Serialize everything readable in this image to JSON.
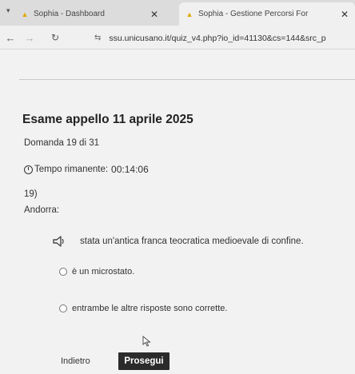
{
  "browser": {
    "tabs": [
      {
        "title": "Sophia - Dashboard",
        "active": false
      },
      {
        "title": "Sophia - Gestione Percorsi For",
        "active": true
      }
    ],
    "url": "ssu.unicusano.it/quiz_v4.php?io_id=41130&cs=144&src_p"
  },
  "exam": {
    "title": "Esame appello 11 aprile 2025",
    "question_counter": "Domanda 19 di 31",
    "timer_label": "Tempo rimanente:",
    "timer_value": "00:14:06"
  },
  "question": {
    "number": "19)",
    "stem": "Andorra:",
    "options": [
      {
        "text": "stata un'antica franca teocratica medioevale di confine."
      },
      {
        "text": "è un microstato."
      },
      {
        "text": "entrambe le altre risposte sono corrette."
      }
    ]
  },
  "nav": {
    "prev_label": "Indietro",
    "next_label": "Prosegui"
  },
  "colors": {
    "primary_button": "#2b2b2b",
    "page_bg": "#f2f2f2"
  }
}
